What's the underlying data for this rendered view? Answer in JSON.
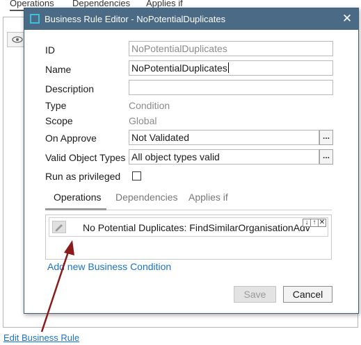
{
  "background": {
    "tabs": [
      {
        "label": "Operations",
        "active": true
      },
      {
        "label": "Dependencies",
        "active": false
      },
      {
        "label": "Applies if",
        "active": false
      }
    ],
    "toolbar_icon": "eye-icon",
    "edit_link": "Edit Business Rule"
  },
  "dialog": {
    "title": "Business Rule Editor - NoPotentialDuplicates",
    "close_icon": "close-icon",
    "fields": {
      "id_label": "ID",
      "id_value": "NoPotentialDuplicates",
      "name_label": "Name",
      "name_value": "NoPotentialDuplicates",
      "description_label": "Description",
      "description_value": "",
      "type_label": "Type",
      "type_value": "Condition",
      "scope_label": "Scope",
      "scope_value": "Global",
      "on_approve_label": "On Approve",
      "on_approve_value": "Not Validated",
      "valid_types_label": "Valid Object Types",
      "valid_types_value": "All object types valid",
      "privileged_label": "Run as privileged",
      "privileged_checked": false,
      "browse_button": "..."
    },
    "tabs": [
      {
        "label": "Operations",
        "active": true
      },
      {
        "label": "Dependencies",
        "active": false
      },
      {
        "label": "Applies if",
        "active": false
      }
    ],
    "operations": [
      {
        "text": "No Potential Duplicates: FindSimilarOrganisationAdv",
        "icon": "pencil-icon"
      }
    ],
    "row_controls": [
      "↓",
      "↑",
      "✕"
    ],
    "add_condition_link": "Add new Business Condition",
    "save_label": "Save",
    "save_enabled": false,
    "cancel_label": "Cancel"
  },
  "colors": {
    "titlebar": "#4a6a85",
    "link": "#1a73c8",
    "arrow": "#8b1a1a"
  }
}
